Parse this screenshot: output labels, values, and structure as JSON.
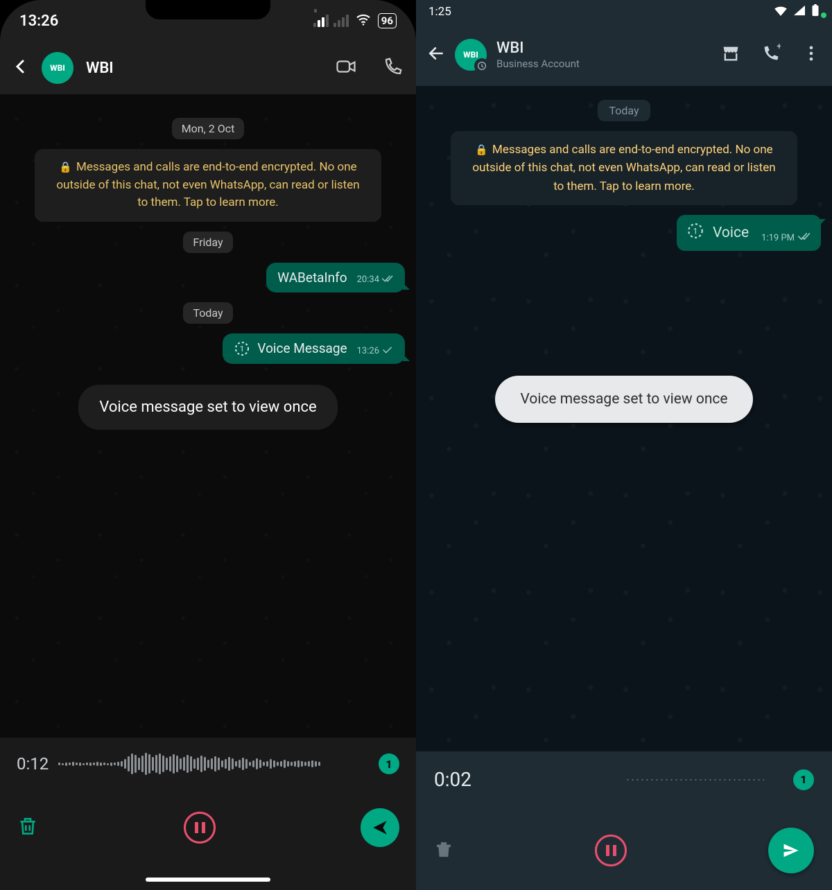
{
  "left": {
    "status": {
      "time": "13:26",
      "battery": "96"
    },
    "header": {
      "avatar_text": "WBI",
      "contact_name": "WBI"
    },
    "chat": {
      "date_mon": "Mon, 2 Oct",
      "encryption_notice": "Messages and calls are end-to-end encrypted. No one outside of this chat, not even WhatsApp, can read or listen to them. Tap to learn more.",
      "date_fri": "Friday",
      "msg_text": "WABetaInfo",
      "msg_time": "20:34",
      "date_today": "Today",
      "voice_label": "Voice Message",
      "voice_time": "13:26",
      "toast": "Voice message set to view once"
    },
    "recorder": {
      "elapsed": "0:12",
      "view_once_badge": "1"
    }
  },
  "right": {
    "status": {
      "time": "1:25"
    },
    "header": {
      "avatar_text": "WBI",
      "contact_name": "WBI",
      "subtitle": "Business Account"
    },
    "chat": {
      "date_today": "Today",
      "encryption_notice": "Messages and calls are end-to-end encrypted. No one outside of this chat, not even WhatsApp, can read or listen to them. Tap to learn more.",
      "voice_label": "Voice",
      "voice_time": "1:19 PM",
      "toast": "Voice message set to view once"
    },
    "recorder": {
      "elapsed": "0:02",
      "view_once_badge": "1"
    }
  }
}
